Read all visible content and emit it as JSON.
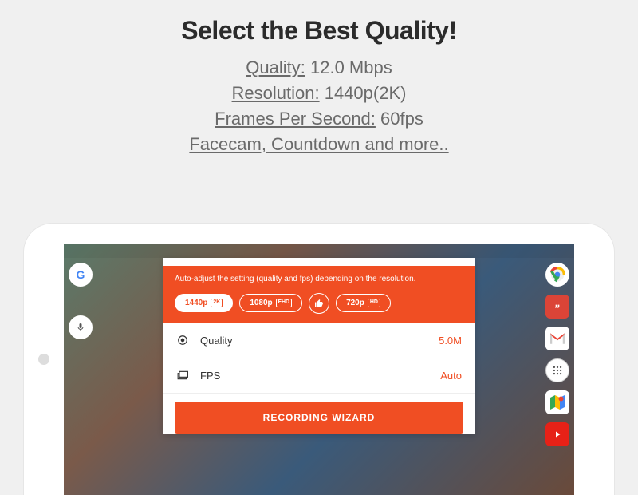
{
  "title": "Select the Best Quality!",
  "specs": {
    "quality_label": "Quality:",
    "quality_value": " 12.0 Mbps",
    "resolution_label": "Resolution:",
    "resolution_value": " 1440p(2K)",
    "fps_label": "Frames Per Second:",
    "fps_value": " 60fps",
    "more_label": "Facecam, Countdown and more.."
  },
  "panel": {
    "hint": "Auto-adjust the setting (quality and fps) depending on the resolution.",
    "options": {
      "r1440_label": "1440p",
      "r1440_badge": "2K",
      "r1080_label": "1080p",
      "r1080_badge": "FHD",
      "r720_label": "720p",
      "r720_badge": "HD"
    },
    "rows": {
      "quality_label": "Quality",
      "quality_value": "5.0M",
      "fps_label": "FPS",
      "fps_value": "Auto"
    },
    "wizard": "RECORDING WIZARD"
  },
  "dock": {
    "google_letter": "G"
  }
}
